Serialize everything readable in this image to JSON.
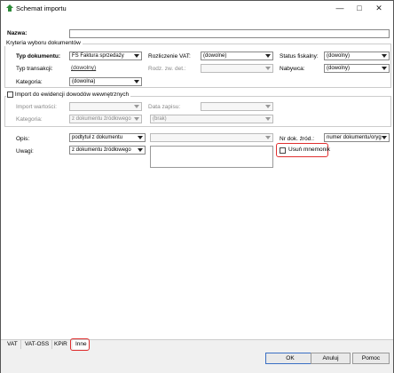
{
  "window": {
    "title": "Schemat importu"
  },
  "nazwa": {
    "label": "Nazwa:",
    "value": ""
  },
  "kryteria": {
    "group_label": "Kryteria wyboru dokumentów",
    "typ_dokumentu": {
      "label": "Typ dokumentu:",
      "value": "FS Faktura sprzedaży"
    },
    "typ_transakcji": {
      "label": "Typ transakcji:",
      "value": "(dowolny)"
    },
    "kategoria": {
      "label": "Kategoria:",
      "value": "(dowolna)"
    },
    "rozliczenie_vat": {
      "label": "Rozliczenie VAT:",
      "value": "(dowolne)"
    },
    "rodz_zw_det": {
      "label": "Rodz. zw. det.:",
      "value": ""
    },
    "status_fiskalny": {
      "label": "Status fiskalny:",
      "value": "(dowolny)"
    },
    "nabywca": {
      "label": "Nabywca:",
      "value": "(dowolny)"
    }
  },
  "import_ewidencji": {
    "label": "Import do ewidencji dowodów wewnętrznych",
    "import_wartosci": {
      "label": "Import wartości:",
      "value": ""
    },
    "data_zapisu": {
      "label": "Data zapisu:",
      "value": ""
    },
    "kategoria": {
      "label": "Kategoria:",
      "value": "z dokumentu źródłowego"
    },
    "kategoria2": {
      "value": "(brak)"
    }
  },
  "opis": {
    "label": "Opis:",
    "value": "podtytuł z dokumentu",
    "extra": ""
  },
  "uwagi": {
    "label": "Uwagi:",
    "value": "z dokumentu źródłowego"
  },
  "nr_dok": {
    "label": "Nr dok. źród.:",
    "value": "numer dokumentu/oryg"
  },
  "usun_mnemonik": {
    "label": "Usuń mnemonik"
  },
  "tabs": [
    {
      "label": "VAT"
    },
    {
      "label": "VAT-OSS"
    },
    {
      "label": "KPiR"
    },
    {
      "label": "Inne"
    }
  ],
  "buttons": {
    "ok": "OK",
    "anuluj": "Anuluj",
    "pomoc": "Pomoc"
  },
  "colors": {
    "highlight": "#e03030",
    "accent": "#3a6fc4"
  }
}
